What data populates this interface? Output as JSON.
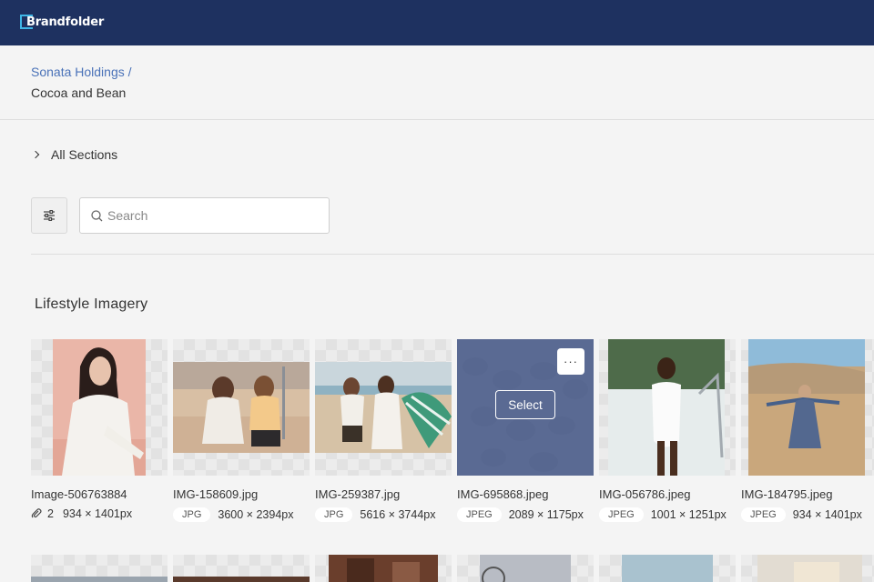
{
  "app": {
    "logo_text": "Brandfolder",
    "brand_color": "#1e3160",
    "accent_color": "#3fb6e6"
  },
  "breadcrumb": {
    "parent": "Sonata Holdings /",
    "current": "Cocoa and Bean"
  },
  "sections_toggle": {
    "label": "All Sections",
    "icon": "chevron-right-icon"
  },
  "toolbar": {
    "filter_icon": "sliders-icon",
    "search_placeholder": "Search",
    "search_value": ""
  },
  "section": {
    "title": "Lifestyle Imagery"
  },
  "assets": [
    {
      "filename": "Image-506763884",
      "attachments": "2",
      "dimensions": "934 × 1401px"
    },
    {
      "filename": "IMG-158609.jpg",
      "type": "JPG",
      "dimensions": "3600 × 2394px"
    },
    {
      "filename": "IMG-259387.jpg",
      "type": "JPG",
      "dimensions": "5616 × 3744px"
    },
    {
      "filename": "IMG-695868.jpeg",
      "type": "JPEG",
      "dimensions": "2089 × 1175px",
      "hover": {
        "menu_label": "···",
        "select_label": "Select"
      }
    },
    {
      "filename": "IMG-056786.jpeg",
      "type": "JPEG",
      "dimensions": "1001 × 1251px"
    },
    {
      "filename": "IMG-184795.jpeg",
      "type": "JPEG",
      "dimensions": "934 × 1401px"
    }
  ]
}
